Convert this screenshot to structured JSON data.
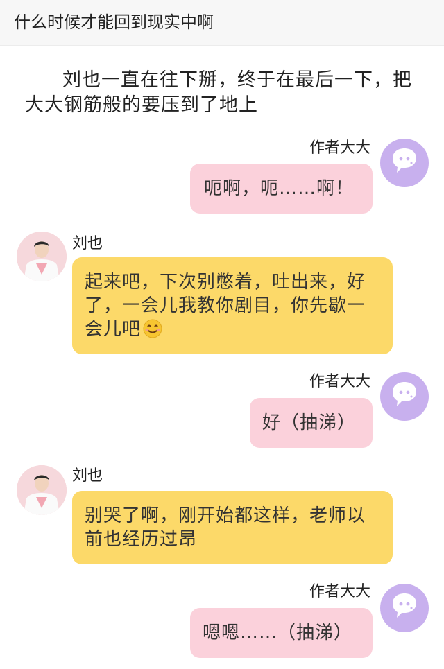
{
  "header": {
    "title": "什么时候才能回到现实中啊"
  },
  "narration": "刘也一直在往下掰，终于在最后一下，把大大钢筋般的要压到了地上",
  "messages": [
    {
      "sender": "作者大大",
      "text": "呃啊，呃……啊！"
    },
    {
      "sender": "刘也",
      "text": "起来吧，下次别憋着，吐出来，好了，一会儿我教你剧目，你先歇一会儿吧"
    },
    {
      "sender": "作者大大",
      "text": "好（抽涕）"
    },
    {
      "sender": "刘也",
      "text": "别哭了啊，刚开始都这样，老师以前也经历过昂"
    },
    {
      "sender": "作者大大",
      "text": "嗯嗯……（抽涕）"
    }
  ],
  "colors": {
    "author_bubble": "#fbd1db",
    "liu_bubble": "#fcd969",
    "author_avatar": "#c8b0ee"
  },
  "icons": {
    "author_avatar": "chat-bubble-icon",
    "emoji": "smiling-face-icon"
  }
}
